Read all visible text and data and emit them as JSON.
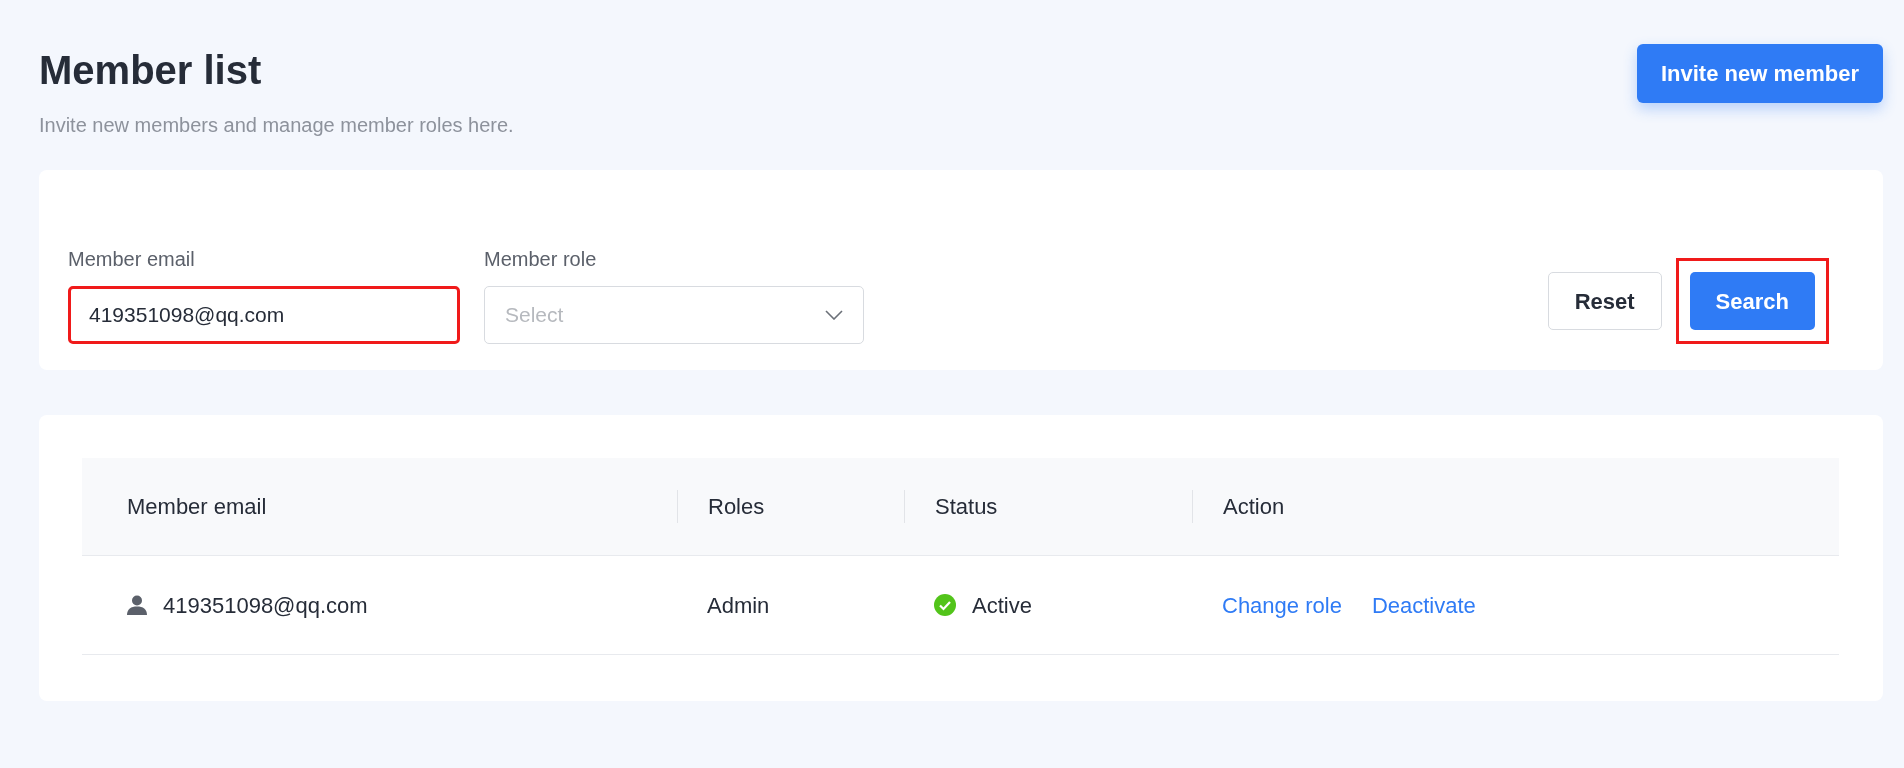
{
  "header": {
    "title": "Member list",
    "subtitle": "Invite new members and manage member roles here.",
    "invite_button": "Invite new member"
  },
  "filters": {
    "email": {
      "label": "Member email",
      "value": "419351098@qq.com",
      "highlighted": true
    },
    "role": {
      "label": "Member role",
      "placeholder": "Select"
    },
    "buttons": [
      {
        "label": "Reset",
        "kind": "secondary",
        "highlighted": false
      },
      {
        "label": "Search",
        "kind": "primary",
        "highlighted": true
      }
    ]
  },
  "table": {
    "columns": [
      "Member email",
      "Roles",
      "Status",
      "Action"
    ],
    "rows": [
      {
        "email": "419351098@qq.com",
        "role": "Admin",
        "status": "Active",
        "active": true,
        "actions": [
          "Change role",
          "Deactivate"
        ]
      }
    ]
  }
}
